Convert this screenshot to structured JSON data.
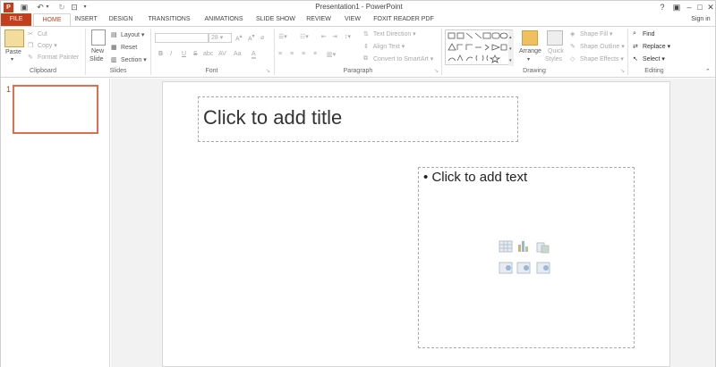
{
  "window": {
    "title": "Presentation1 - PowerPoint",
    "help": "?",
    "sign_in": "Sign in"
  },
  "icons": {
    "app": "powerpoint-logo-icon",
    "save": "save-icon",
    "undo": "undo-icon",
    "redo": "redo-icon"
  },
  "tabs": [
    "FILE",
    "HOME",
    "INSERT",
    "DESIGN",
    "TRANSITIONS",
    "ANIMATIONS",
    "SLIDE SHOW",
    "REVIEW",
    "VIEW",
    "FOXIT READER PDF"
  ],
  "ribbon": {
    "clipboard": {
      "paste": "Paste",
      "cut": "Cut",
      "copy": "Copy",
      "format_painter": "Format Painter",
      "label": "Clipboard"
    },
    "slides": {
      "new_slide_1": "New",
      "new_slide_2": "Slide",
      "layout": "Layout",
      "reset": "Reset",
      "section": "Section",
      "label": "Slides"
    },
    "font": {
      "size": "28",
      "bold": "B",
      "italic": "I",
      "underline": "U",
      "strike": "S",
      "shadow": "abc",
      "spacing": "AV",
      "case": "Aa",
      "label": "Font"
    },
    "paragraph": {
      "text_direction": "Text Direction",
      "align_text": "Align Text",
      "convert": "Convert to SmartArt",
      "label": "Paragraph"
    },
    "drawing": {
      "arrange": "Arrange",
      "quick_styles_1": "Quick",
      "quick_styles_2": "Styles",
      "shape_fill": "Shape Fill",
      "shape_outline": "Shape Outline",
      "shape_effects": "Shape Effects",
      "label": "Drawing"
    },
    "editing": {
      "find": "Find",
      "replace": "Replace",
      "select": "Select",
      "label": "Editing"
    }
  },
  "slides_pane": {
    "slide_number": "1"
  },
  "slide": {
    "title_placeholder": "Click to add title",
    "content_placeholder": "Click to add text",
    "bullet": "•"
  },
  "colors": {
    "accent": "#c43e1c",
    "selection": "#e46c4f"
  }
}
